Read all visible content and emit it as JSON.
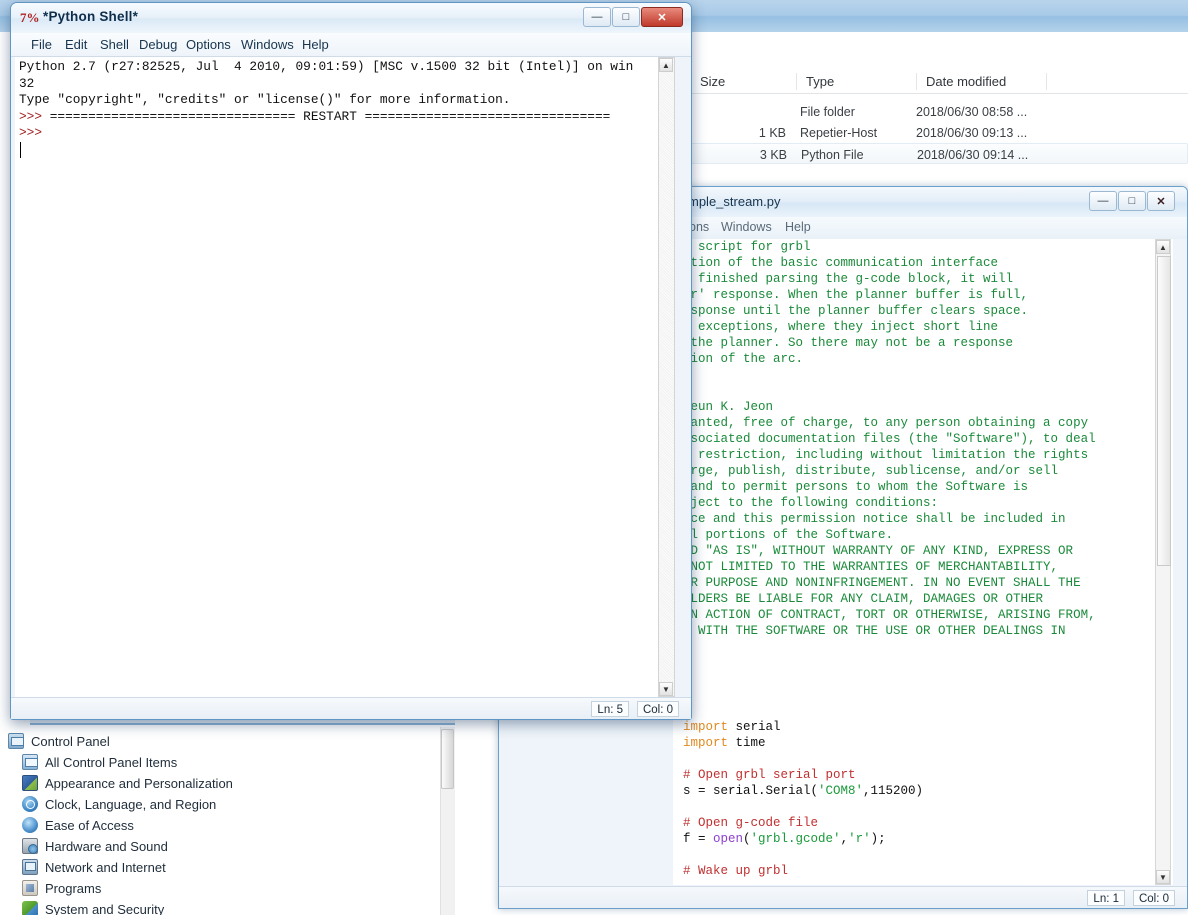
{
  "explorer": {
    "columns": [
      "Size",
      "Type",
      "Date modified"
    ],
    "rows": [
      {
        "size": "",
        "type": "File folder",
        "date": "2018/06/30 08:58 ...",
        "selected": false
      },
      {
        "size": "1 KB",
        "type": "Repetier-Host",
        "date": "2018/06/30 09:13 ...",
        "selected": false
      },
      {
        "size": "3 KB",
        "type": "Python File",
        "date": "2018/06/30 09:14 ...",
        "selected": true
      }
    ]
  },
  "control_panel": {
    "items": [
      {
        "label": "Control Panel",
        "icon": "control-panel-icon",
        "root": true
      },
      {
        "label": "All Control Panel Items",
        "icon": "all-items-icon",
        "root": false
      },
      {
        "label": "Appearance and Personalization",
        "icon": "appearance-icon",
        "root": false
      },
      {
        "label": "Clock, Language, and Region",
        "icon": "clock-icon",
        "root": false
      },
      {
        "label": "Ease of Access",
        "icon": "ease-of-access-icon",
        "root": false
      },
      {
        "label": "Hardware and Sound",
        "icon": "hardware-icon",
        "root": false
      },
      {
        "label": "Network and Internet",
        "icon": "network-icon",
        "root": false
      },
      {
        "label": "Programs",
        "icon": "programs-icon",
        "root": false
      },
      {
        "label": "System and Security",
        "icon": "system-security-icon",
        "root": false
      }
    ]
  },
  "shell_window": {
    "title": "*Python Shell*",
    "app_icon": "python-idle-icon",
    "menus": [
      "File",
      "Edit",
      "Shell",
      "Debug",
      "Options",
      "Windows",
      "Help"
    ],
    "window_buttons": {
      "minimize": "—",
      "restore": "□",
      "close": "✕"
    },
    "lines": [
      "Python 2.7 (r27:82525, Jul  4 2010, 09:01:59) [MSC v.1500 32 bit (Intel)] on win",
      "32",
      "Type \"copyright\", \"credits\" or \"license()\" for more information."
    ],
    "restart_line": {
      "prompt": ">>> ",
      "text": "================================ RESTART ================================"
    },
    "last_prompt": ">>> ",
    "status": {
      "line": "Ln: 5",
      "col": "Col: 0"
    }
  },
  "editor_window": {
    "title": "mple_stream.py",
    "menus": [
      "ons",
      "Windows",
      "Help"
    ],
    "window_buttons": {
      "minimize": "—",
      "restore": "□",
      "close": "✕"
    },
    "status": {
      "line": "Ln: 1",
      "col": "Col: 0"
    },
    "docstring_lines": [
      "g script for grbl",
      "ation of the basic communication interface",
      "s finished parsing the g-code block, it will",
      "or' response. When the planner buffer is full,",
      "esponse until the planner buffer clears space.",
      ". exceptions, where they inject short line",
      " the planner. So there may not be a response",
      "tion of the arc.",
      "",
      "",
      "geun K. Jeon",
      "ranted, free of charge, to any person obtaining a copy",
      "ssociated documentation files (the \"Software\"), to deal",
      "t restriction, including without limitation the rights",
      "erge, publish, distribute, sublicense, and/or sell",
      " and to permit persons to whom the Software is",
      "bject to the following conditions:",
      "ice and this permission notice shall be included in",
      "al portions of the Software.",
      "ED \"AS IS\", WITHOUT WARRANTY OF ANY KIND, EXPRESS OR",
      " NOT LIMITED TO THE WARRANTIES OF MERCHANTABILITY,",
      "AR PURPOSE AND NONINFRINGEMENT. IN NO EVENT SHALL THE",
      "OLDERS BE LIABLE FOR ANY CLAIM, DAMAGES OR OTHER",
      "AN ACTION OF CONTRACT, TORT OR OTHERWISE, ARISING FROM,",
      "N WITH THE SOFTWARE OR THE USE OR OTHER DEALINGS IN"
    ],
    "code_lines": [
      {
        "segments": [
          {
            "t": "import",
            "c": "kw"
          },
          {
            "t": " serial",
            "c": "pl"
          }
        ]
      },
      {
        "segments": [
          {
            "t": "import",
            "c": "kw"
          },
          {
            "t": " time",
            "c": "pl"
          }
        ]
      },
      {
        "segments": []
      },
      {
        "segments": [
          {
            "t": "# Open grbl serial port",
            "c": "cm-red"
          }
        ]
      },
      {
        "segments": [
          {
            "t": "s = serial.Serial(",
            "c": "pl"
          },
          {
            "t": "'COM8'",
            "c": "st"
          },
          {
            "t": ",115200)",
            "c": "pl"
          }
        ]
      },
      {
        "segments": []
      },
      {
        "segments": [
          {
            "t": "# Open g-code file",
            "c": "cm-red"
          }
        ]
      },
      {
        "segments": [
          {
            "t": "f = ",
            "c": "pl"
          },
          {
            "t": "open",
            "c": "fn"
          },
          {
            "t": "(",
            "c": "pl"
          },
          {
            "t": "'grbl.gcode'",
            "c": "st"
          },
          {
            "t": ",",
            "c": "pl"
          },
          {
            "t": "'r'",
            "c": "st"
          },
          {
            "t": ");",
            "c": "pl"
          }
        ]
      },
      {
        "segments": []
      },
      {
        "segments": [
          {
            "t": "# Wake up grbl",
            "c": "cm-red"
          }
        ]
      }
    ]
  },
  "colors": {
    "comment_green": "#1a8a3a",
    "comment_red": "#c03030",
    "keyword_orange": "#e08a22",
    "string_green": "#1a9a3a",
    "builtin_purple": "#8d3fd0",
    "prompt_red": "#a02020",
    "close_button_red": "#c0392b",
    "aero_blue": "#a8cae8"
  }
}
